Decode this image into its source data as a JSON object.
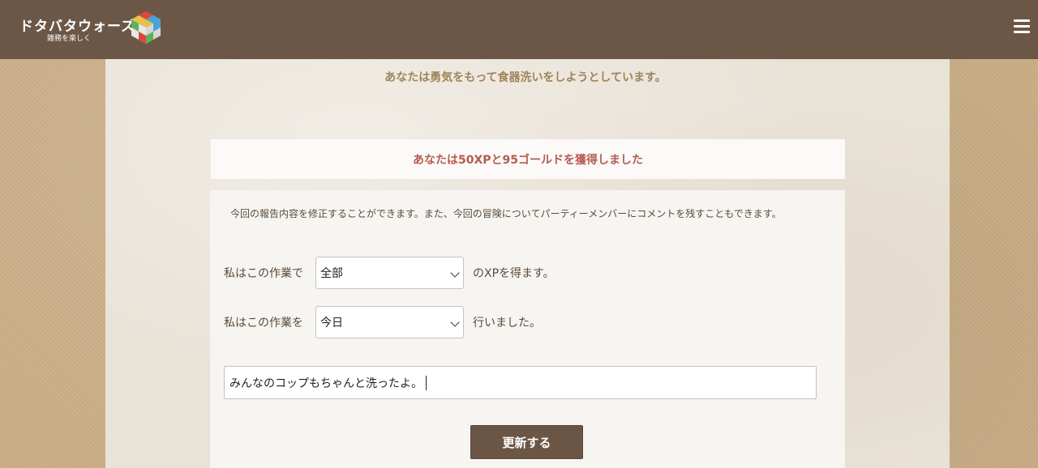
{
  "header": {
    "logo_title": "ドタバタウォーズ",
    "logo_subtitle": "雑務を楽しく",
    "menu_icon": "hamburger-menu-icon"
  },
  "main": {
    "intro_text": "あなたは勇気をもって食器洗いをしようとしています。",
    "reward_text": "あなたは50XPと95ゴールドを獲得しました",
    "note_text": "今回の報告内容を修正することができます。また、今回の冒険についてパーティーメンバーにコメントを残すこともできます。",
    "form": {
      "row1_label": "私はこの作業で",
      "xp_select_value": "全部",
      "row1_suffix": "のXPを得ます。",
      "row2_label": "私はこの作業を",
      "date_select_value": "今日",
      "row2_suffix": "行いました。",
      "comment_value": "みんなのコップもちゃんと洗ったよ。",
      "submit_label": "更新する"
    }
  },
  "colors": {
    "header_bg": "#6c5747",
    "intro_text": "#a08459",
    "reward_text": "#b65a52",
    "button_bg": "#6b5645"
  }
}
